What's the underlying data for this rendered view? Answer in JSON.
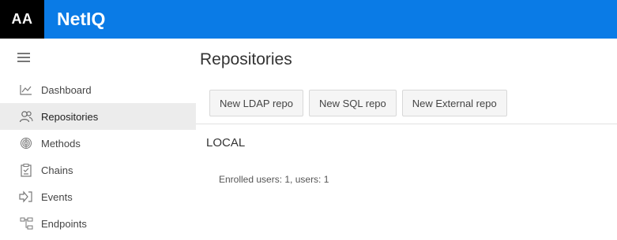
{
  "header": {
    "logo_text": "AA",
    "app_title": "NetIQ",
    "bg_color": "#0a7be6"
  },
  "sidebar": {
    "menu_icon": "hamburger-icon",
    "items": [
      {
        "label": "Dashboard",
        "icon": "chart-line-icon",
        "active": false
      },
      {
        "label": "Repositories",
        "icon": "users-icon",
        "active": true
      },
      {
        "label": "Methods",
        "icon": "fingerprint-icon",
        "active": false
      },
      {
        "label": "Chains",
        "icon": "clipboard-check-icon",
        "active": false
      },
      {
        "label": "Events",
        "icon": "sign-in-arrow-icon",
        "active": false
      },
      {
        "label": "Endpoints",
        "icon": "sitemap-icon",
        "active": false
      }
    ]
  },
  "main": {
    "title": "Repositories",
    "buttons": [
      {
        "label": "New LDAP repo"
      },
      {
        "label": "New SQL repo"
      },
      {
        "label": "New External repo"
      }
    ],
    "section_title": "LOCAL",
    "info_text": "Enrolled users: 1, users: 1"
  }
}
